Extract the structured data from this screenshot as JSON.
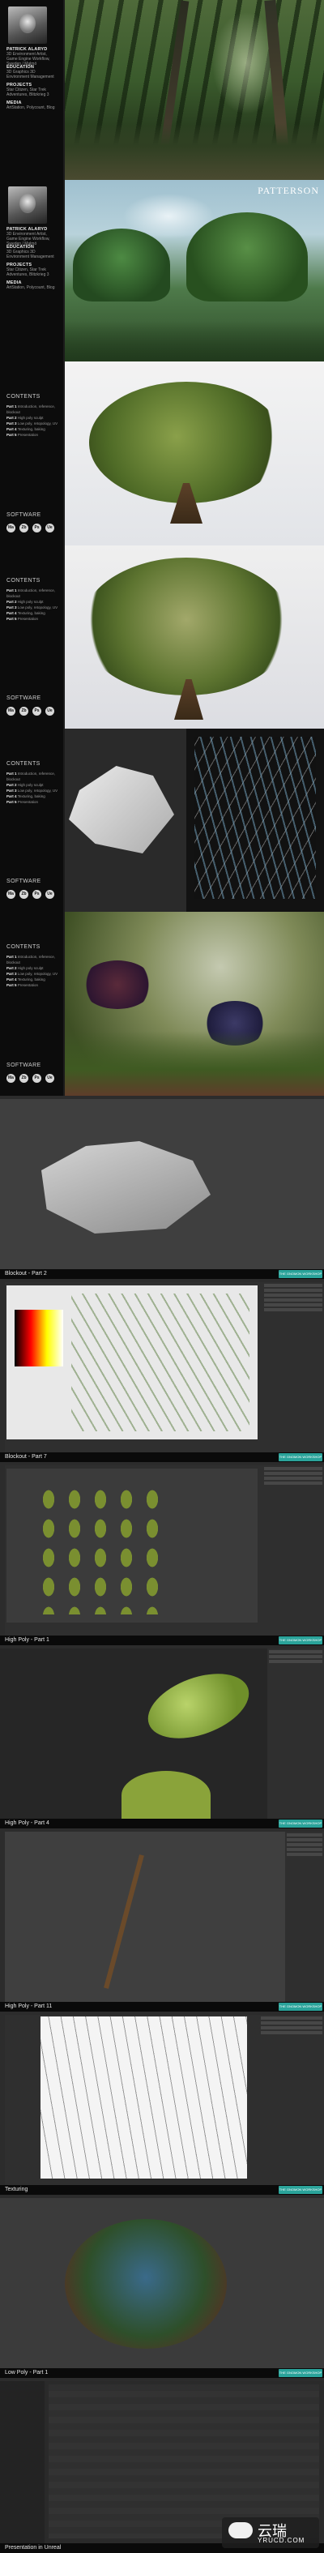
{
  "artist": {
    "name": "PATRICK ALARYD",
    "bio": "3D Environment Artist, Game Engine Workflow, Sweden / Malmö",
    "education_h": "EDUCATION",
    "education": "3D Graphics 3D Environment Management",
    "projects_h": "PROJECTS",
    "projects": "Star Citizen, Star Trek Adventures, Blitzkrieg 3",
    "media_h": "MEDIA",
    "media": "ArtStation, Polycount, Blog"
  },
  "hero2_text": "PATTERSON",
  "contents": {
    "heading": "CONTENTS",
    "items": [
      {
        "k": "Part 1",
        "v": "Introduction, reference, blockout"
      },
      {
        "k": "Part 2",
        "v": "High poly sculpt"
      },
      {
        "k": "Part 3",
        "v": "Low poly, retopology, UV"
      },
      {
        "k": "Part 4",
        "v": "Texturing, baking"
      },
      {
        "k": "Part 5",
        "v": "Presentation"
      }
    ]
  },
  "software": {
    "heading": "SOFTWARE",
    "icons": [
      "Ma",
      "Zb",
      "Ps",
      "Ue"
    ]
  },
  "steps": [
    {
      "label": "Blockout - Part 2"
    },
    {
      "label": "Blockout - Part 7"
    },
    {
      "label": "High Poly - Part 1"
    },
    {
      "label": "High Poly - Part 4"
    },
    {
      "label": "High Poly - Part 11"
    },
    {
      "label": "Texturing"
    },
    {
      "label": "Low Poly - Part 1"
    },
    {
      "label": "Presentation in Unreal"
    }
  ],
  "badge": "THE GNOMON WORKSHOP",
  "watermark": {
    "cn": "云瑞",
    "en": "YRUCD.COM"
  }
}
